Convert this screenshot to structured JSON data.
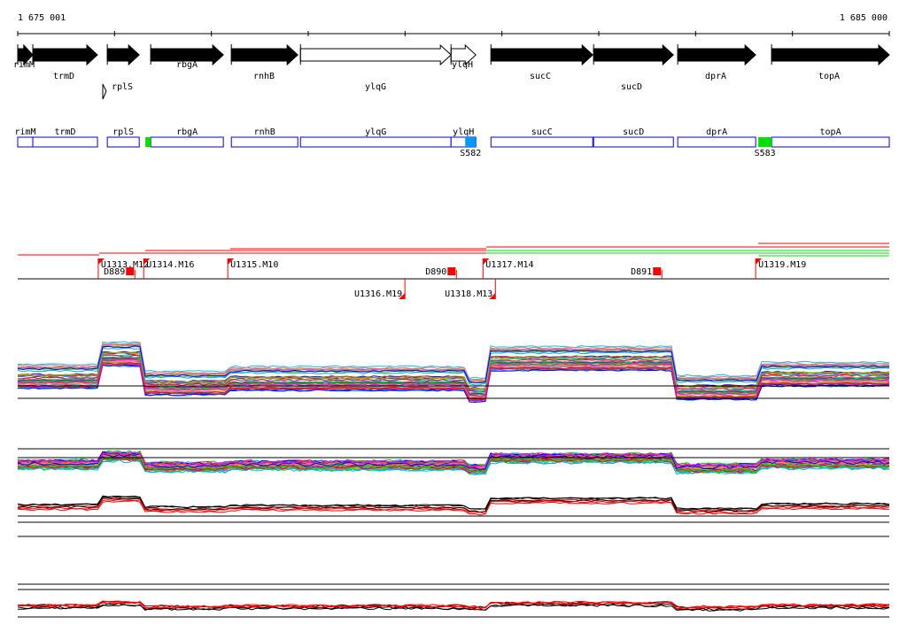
{
  "ruler": {
    "start": 1675001,
    "end": 1685000,
    "start_label": "1 675 001",
    "end_label": "1 685 000"
  },
  "genes": [
    {
      "name": "rimM",
      "start": 1675001,
      "end": 1675174,
      "fill": "black"
    },
    {
      "name": "trmD",
      "start": 1675174,
      "end": 1675916,
      "fill": "black"
    },
    {
      "name": "rplS",
      "start": 1676029,
      "end": 1676395,
      "fill": "black"
    },
    {
      "name": "rbgA",
      "start": 1676527,
      "end": 1677360,
      "fill": "black"
    },
    {
      "name": "rnhB",
      "start": 1677452,
      "end": 1678214,
      "fill": "black"
    },
    {
      "name": "ylqG",
      "start": 1678245,
      "end": 1679972,
      "fill": "white"
    },
    {
      "name": "ylqH",
      "start": 1679972,
      "end": 1680257,
      "fill": "white"
    },
    {
      "name": "sucC",
      "start": 1680430,
      "end": 1681598,
      "fill": "black"
    },
    {
      "name": "sucD",
      "start": 1681608,
      "end": 1682523,
      "fill": "black"
    },
    {
      "name": "dprA",
      "start": 1682573,
      "end": 1683467,
      "fill": "black"
    },
    {
      "name": "topA",
      "start": 1683650,
      "end": 1685000,
      "fill": "black"
    }
  ],
  "sites": [
    {
      "label": "",
      "start": 1676466,
      "end": 1676527,
      "color": "#00e000"
    },
    {
      "label": "S582",
      "start": 1680135,
      "end": 1680257,
      "color": "#0099ff"
    },
    {
      "label": "S583",
      "start": 1683497,
      "end": 1683650,
      "color": "#00e000"
    }
  ],
  "features_top": [
    {
      "label": "U1313.M12",
      "pos": 1675925
    },
    {
      "label": "U1314.M16",
      "pos": 1676446
    },
    {
      "label": "U1315.M10",
      "pos": 1677411
    },
    {
      "label": "U1317.M14",
      "pos": 1680339
    },
    {
      "label": "U1319.M19",
      "pos": 1683467
    }
  ],
  "features_mid": [
    {
      "label": "D889",
      "pos": 1676345
    },
    {
      "label": "D890",
      "pos": 1680034
    },
    {
      "label": "D891",
      "pos": 1682391
    }
  ],
  "features_bottom": [
    {
      "label": "U1316.M19",
      "pos": 1679443
    },
    {
      "label": "U1318.M13",
      "pos": 1680481
    }
  ]
}
